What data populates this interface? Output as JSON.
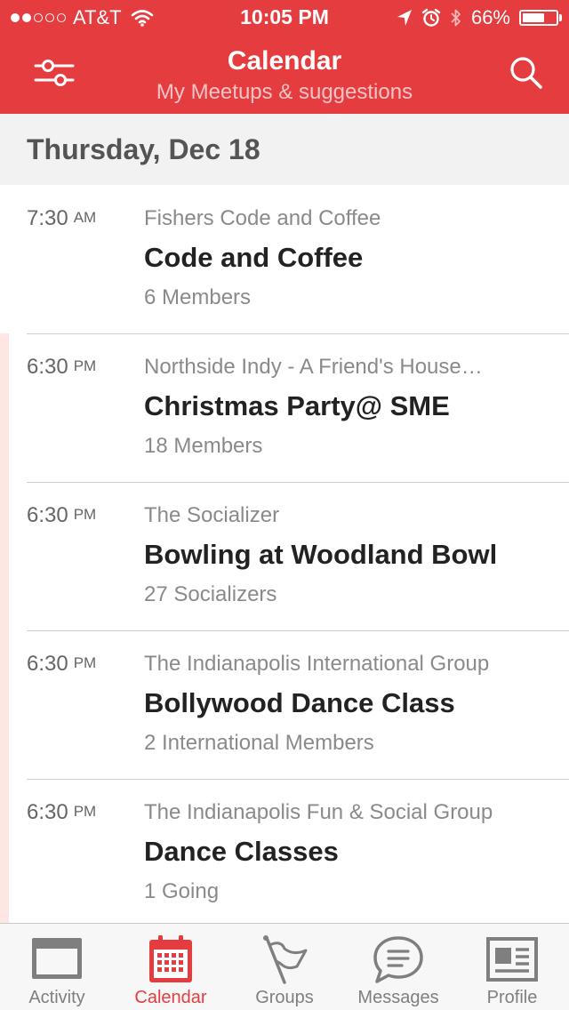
{
  "status_bar": {
    "carrier": "AT&T",
    "signal_filled": 2,
    "signal_total": 5,
    "time": "10:05 PM",
    "battery_percent": "66%",
    "battery_level": 0.66
  },
  "nav": {
    "title": "Calendar",
    "subtitle": "My Meetups & suggestions",
    "left_icon": "filter-sliders-icon",
    "right_icon": "search-icon"
  },
  "date_header": "Thursday, Dec 18",
  "events": [
    {
      "time": "7:30",
      "ampm": "AM",
      "group": "Fishers Code and Coffee",
      "title": "Code and Coffee",
      "members": "6 Members",
      "accent": false
    },
    {
      "time": "6:30",
      "ampm": "PM",
      "group": "Northside Indy - A Friend's House…",
      "title": "Christmas Party@ SME",
      "members": "18 Members",
      "accent": true
    },
    {
      "time": "6:30",
      "ampm": "PM",
      "group": "The Socializer",
      "title": "Bowling at Woodland Bowl",
      "members": "27 Socializers",
      "accent": true
    },
    {
      "time": "6:30",
      "ampm": "PM",
      "group": "The Indianapolis International Group",
      "title": "Bollywood Dance Class",
      "members": "2 International Members",
      "accent": true
    },
    {
      "time": "6:30",
      "ampm": "PM",
      "group": "The Indianapolis Fun & Social Group",
      "title": "Dance Classes",
      "members": "1 Going",
      "accent": true
    }
  ],
  "tabs": [
    {
      "label": "Activity",
      "icon": "activity-window-icon",
      "active": false
    },
    {
      "label": "Calendar",
      "icon": "calendar-icon",
      "active": true
    },
    {
      "label": "Groups",
      "icon": "groups-flag-icon",
      "active": false
    },
    {
      "label": "Messages",
      "icon": "messages-bubble-icon",
      "active": false
    },
    {
      "label": "Profile",
      "icon": "profile-card-icon",
      "active": false
    }
  ],
  "colors": {
    "brand_red": "#e43c3f",
    "accent_pink": "#fde6e3",
    "tab_inactive": "#7f7f7f"
  }
}
